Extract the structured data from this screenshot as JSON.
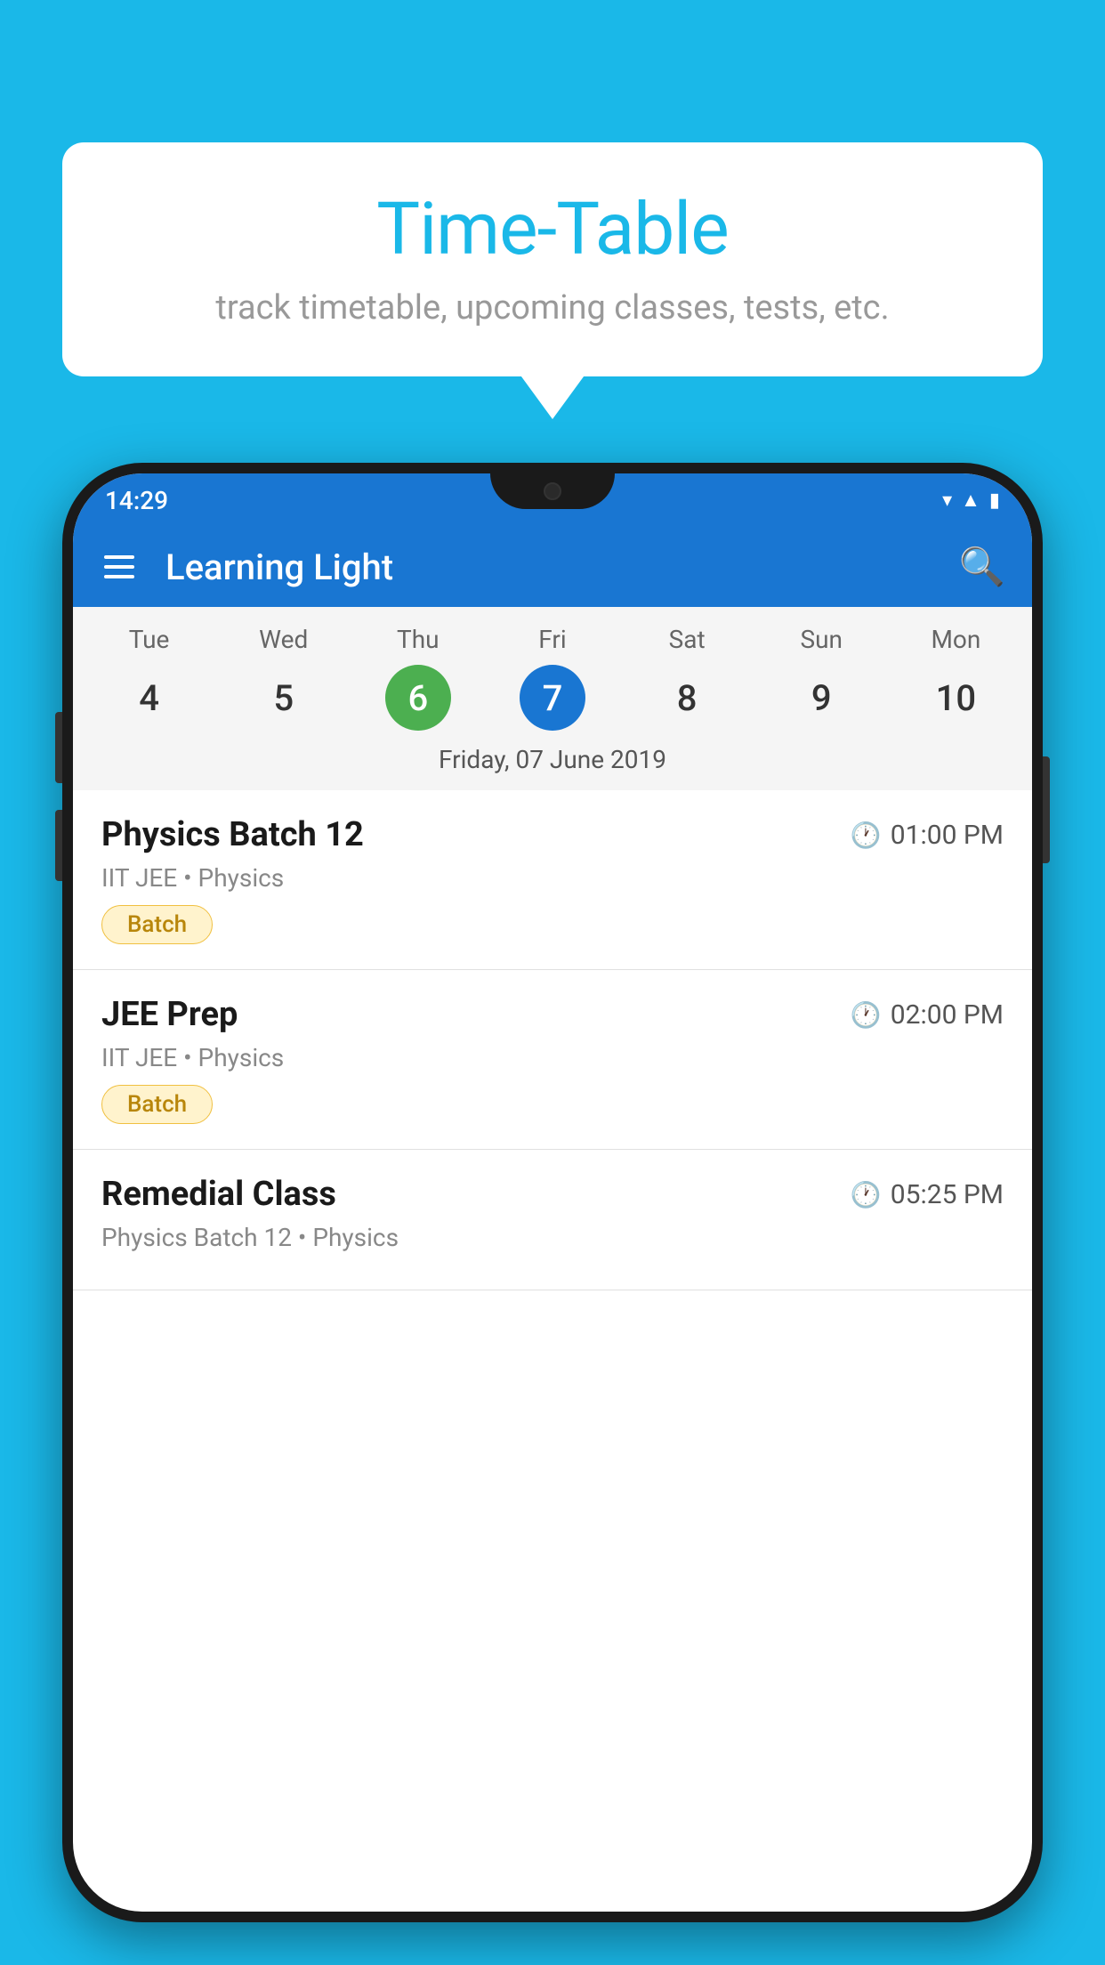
{
  "background_color": "#1ab8e8",
  "bubble": {
    "title": "Time-Table",
    "subtitle": "track timetable, upcoming classes, tests, etc."
  },
  "app": {
    "title": "Learning Light",
    "status_time": "14:29"
  },
  "calendar": {
    "selected_date_label": "Friday, 07 June 2019",
    "days": [
      {
        "name": "Tue",
        "number": "4",
        "state": "normal"
      },
      {
        "name": "Wed",
        "number": "5",
        "state": "normal"
      },
      {
        "name": "Thu",
        "number": "6",
        "state": "today"
      },
      {
        "name": "Fri",
        "number": "7",
        "state": "selected"
      },
      {
        "name": "Sat",
        "number": "8",
        "state": "normal"
      },
      {
        "name": "Sun",
        "number": "9",
        "state": "normal"
      },
      {
        "name": "Mon",
        "number": "10",
        "state": "normal"
      }
    ]
  },
  "schedule": {
    "items": [
      {
        "title": "Physics Batch 12",
        "time": "01:00 PM",
        "subtitle": "IIT JEE • Physics",
        "badge": "Batch"
      },
      {
        "title": "JEE Prep",
        "time": "02:00 PM",
        "subtitle": "IIT JEE • Physics",
        "badge": "Batch"
      },
      {
        "title": "Remedial Class",
        "time": "05:25 PM",
        "subtitle": "Physics Batch 12 • Physics",
        "badge": null
      }
    ]
  },
  "labels": {
    "batch": "Batch"
  }
}
